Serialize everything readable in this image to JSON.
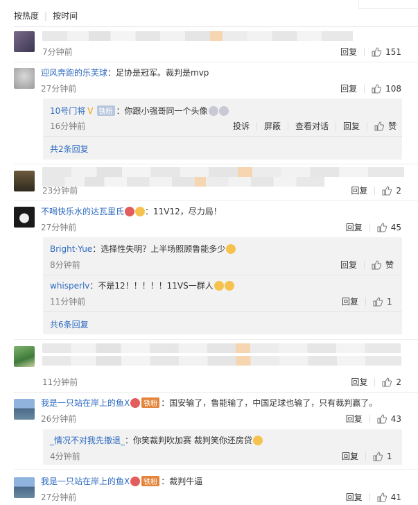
{
  "tabs": {
    "hot": "按热度",
    "time": "按时间"
  },
  "comments": [
    {
      "name": "",
      "text": "",
      "time": "7分钟前",
      "likes": "151"
    },
    {
      "name": "迎风奔跑的乐芙球",
      "text": "：足协是冠军。裁判是mvp",
      "time": "27分钟前",
      "likes": "108"
    },
    {
      "name": "",
      "text": "",
      "time": "23分钟前",
      "likes": "2"
    },
    {
      "name": "不喝快乐水的达瓦里氏",
      "text": "：11V12，尽力局！",
      "time": "27分钟前",
      "likes": "45"
    },
    {
      "name": "",
      "text": "",
      "time": "11分钟前",
      "likes": "2"
    },
    {
      "name": "我是一只站在岸上的鱼X",
      "text": "：国安输了，鲁能输了，中国足球也输了，只有裁判赢了。",
      "time": "26分钟前",
      "likes": "43"
    },
    {
      "name": "我是一只站在岸上的鱼X",
      "text": "：裁判牛逼",
      "time": "27分钟前",
      "likes": "41"
    }
  ],
  "replies": [
    {
      "name": "10号门将",
      "badge": "铁粉",
      "text": "：你跟小强哥同一个头像",
      "time": "16分钟前",
      "actions": [
        "投诉",
        "屏蔽",
        "查看对话",
        "回复"
      ],
      "like": "赞"
    },
    {
      "name": "Bright·Yue",
      "text": "：选择性失明？上半场照顾鲁能多少",
      "time": "8分钟前",
      "like": "赞"
    },
    {
      "name": "whisperlv",
      "text": "：不是12！！！！！11VS一群人",
      "time": "11分钟前",
      "like": "1"
    },
    {
      "name": "_情况不对我先撤退_",
      "text": "：你笑裁判吹加赛 裁判笑你还房贷",
      "time": "4分钟前",
      "like": "1"
    }
  ],
  "badges": {
    "iron": "铁粉"
  },
  "more": {
    "first": "共2条回复",
    "second": "共6条回复"
  },
  "reply_label": "回复"
}
